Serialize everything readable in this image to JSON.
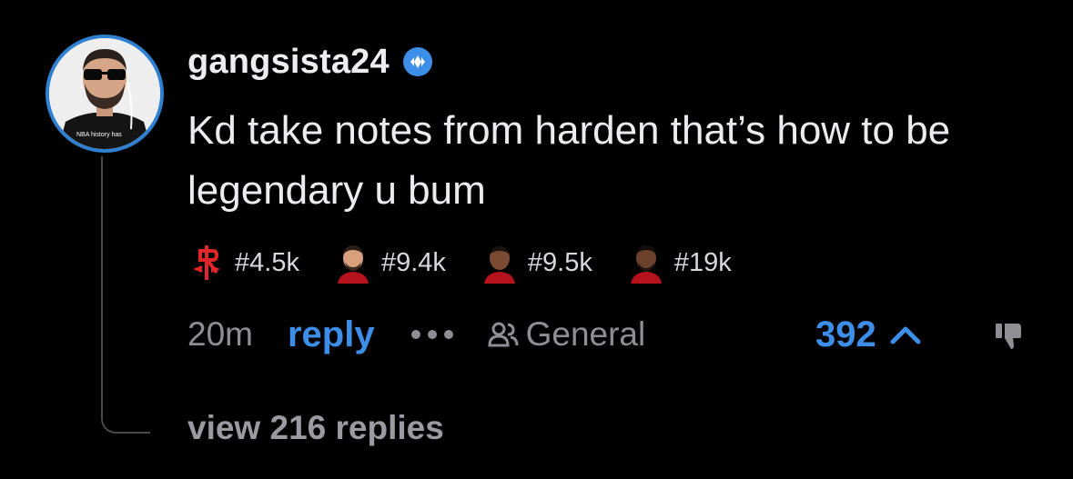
{
  "comment": {
    "username": "gangsista24",
    "text": "Kd take notes from harden that’s how to be legendary u bum",
    "avatar_shirt_text": "NBA history has",
    "flairs": [
      {
        "icon": "rockets-logo-icon",
        "label": "#4.5k"
      },
      {
        "icon": "player-avatar-icon",
        "label": "#9.4k"
      },
      {
        "icon": "player-avatar-icon",
        "label": "#9.5k"
      },
      {
        "icon": "player-avatar-icon",
        "label": "#19k"
      }
    ],
    "time": "20m",
    "reply_label": "reply",
    "group_label": "General",
    "upvotes": "392",
    "view_replies": "view 216 replies"
  },
  "colors": {
    "background": "#000000",
    "accent": "#3d8ee8",
    "muted": "#8e8e93",
    "avatar_ring": "#2f80d1"
  },
  "icons": {
    "verified": "verified-badge-icon",
    "more": "more-dots-icon",
    "group": "people-icon",
    "upvote": "chevron-up-icon",
    "downvote": "thumbs-down-icon"
  }
}
